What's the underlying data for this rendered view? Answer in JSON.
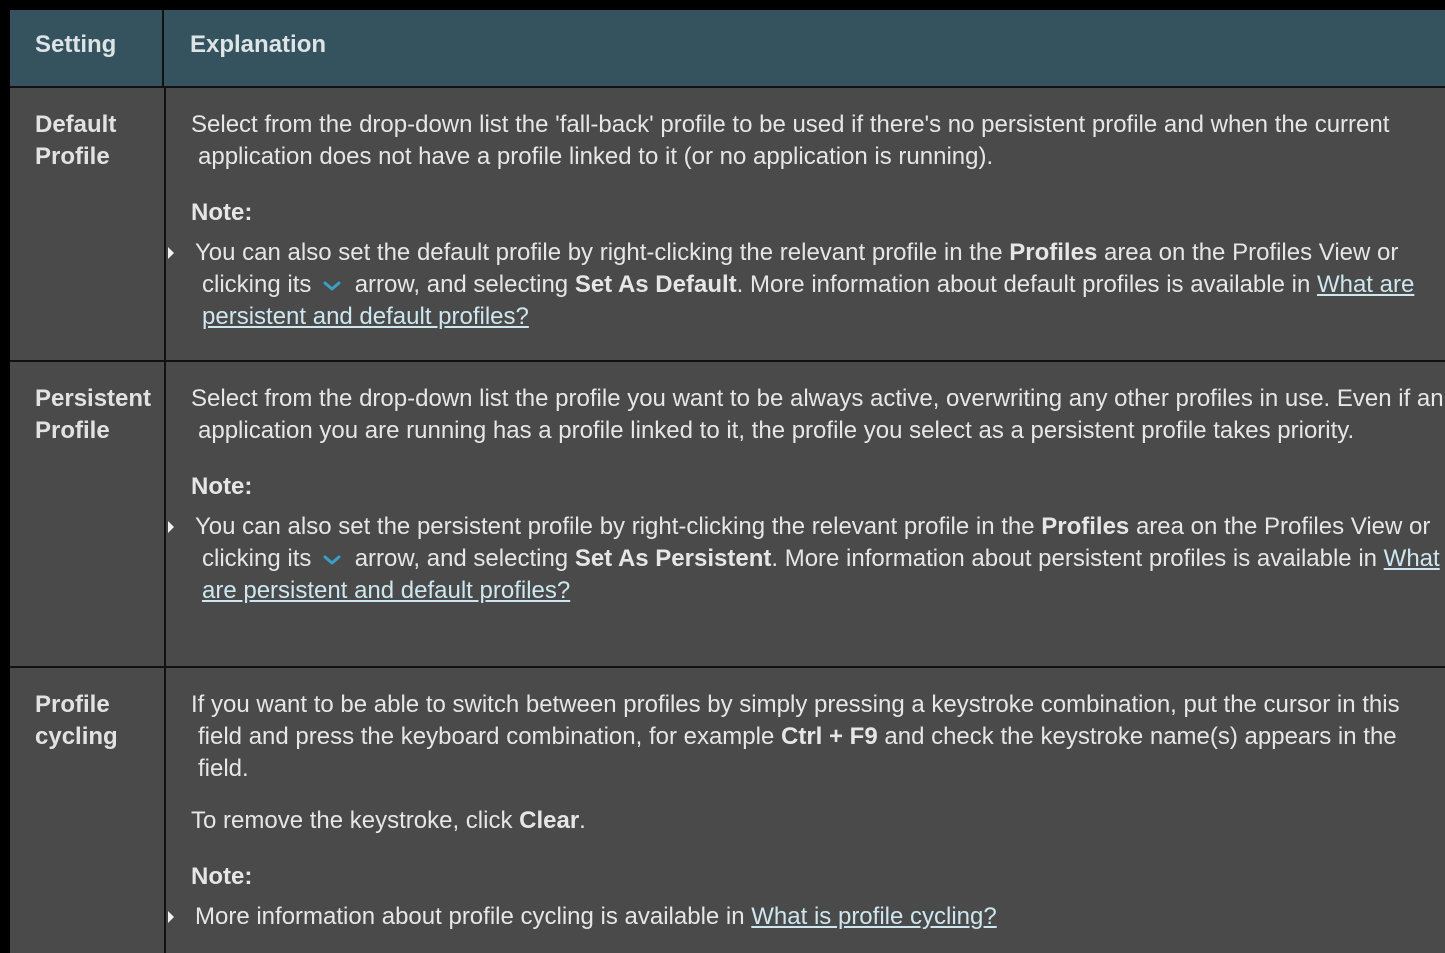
{
  "header": {
    "setting": "Setting",
    "explanation": "Explanation"
  },
  "rows": [
    {
      "name": "Default Profile",
      "desc": "Select from the drop-down list the 'fall-back' profile to be used if there's no persistent profile and when the current application does not have a profile linked to it (or no application is running).",
      "note_label": "Note:",
      "note": {
        "t1": "You can also set the default profile by right-clicking the relevant profile in the ",
        "b1": "Profiles",
        "t2": " area on the Profiles View or clicking its ",
        "t3": " arrow, and selecting ",
        "b2": "Set As Default",
        "t4": ". More information about default profiles is available in ",
        "link": "What are persistent and default profiles?"
      }
    },
    {
      "name": "Persistent Profile",
      "desc": "Select from the drop-down list the profile you want to be always active, overwriting any other profiles in use. Even if an application you are running has a profile linked to it, the profile you select as a persistent profile takes priority.",
      "note_label": "Note:",
      "note": {
        "t1": "You can also set the persistent profile by right-clicking the relevant profile in the ",
        "b1": "Profiles",
        "t2": " area on the Profiles View or clicking its ",
        "t3": " arrow, and selecting ",
        "b2": "Set As Persistent",
        "t4": ". More information about persistent profiles is available in ",
        "link": "What are persistent and default profiles?"
      }
    },
    {
      "name": "Profile cycling",
      "desc_t1": "If you want to be able to switch between profiles by simply pressing a keystroke combination, put the cursor in this field and press the keyboard combination, for example ",
      "desc_b1": "Ctrl + F9",
      "desc_t2": " and check the keystroke name(s) appears in the field.",
      "clear_t1": "To remove the keystroke, click ",
      "clear_b1": "Clear",
      "clear_t2": ".",
      "note_label": "Note:",
      "note": {
        "t1": "More information about profile cycling is available in ",
        "link": "What is profile cycling?"
      }
    }
  ],
  "colors": {
    "header_bg": "#35535e",
    "body_bg": "#4a4a4a",
    "link": "#cde6ef",
    "chevron": "#3a9fc4"
  }
}
